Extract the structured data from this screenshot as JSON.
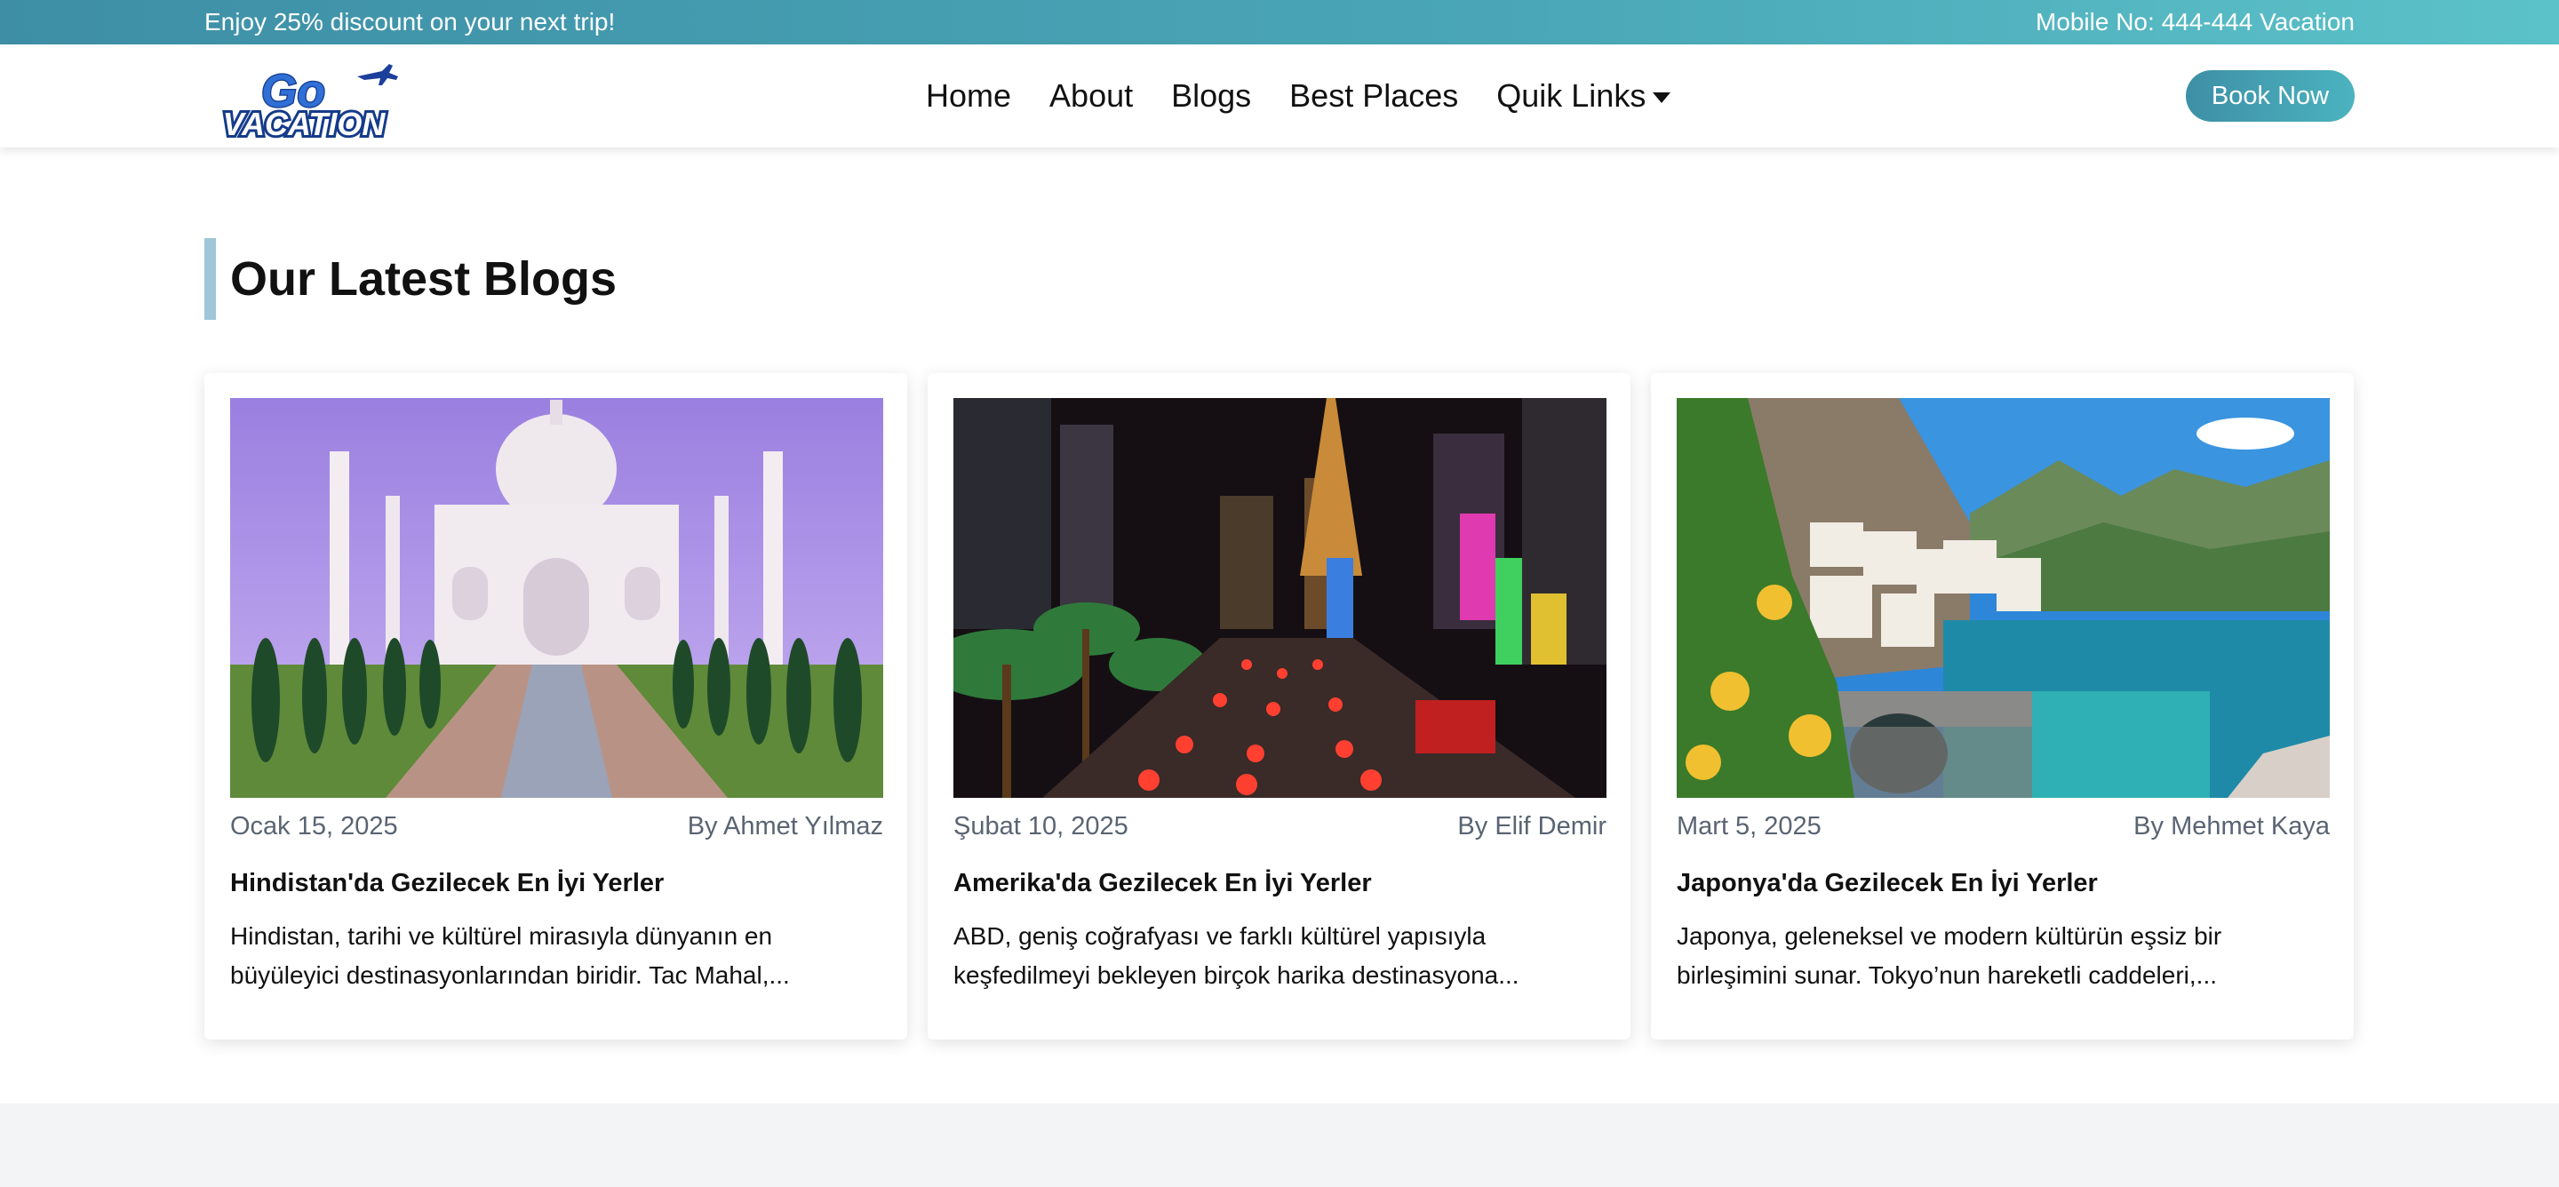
{
  "topbar": {
    "promo": "Enjoy 25% discount on your next trip!",
    "phone": "Mobile No: 444-444 Vacation",
    "gradient": [
      "#3e8fa6",
      "#5cc2c9"
    ]
  },
  "header": {
    "logo_top": "Go",
    "logo_bottom": "VACATION",
    "nav": [
      "Home",
      "About",
      "Blogs",
      "Best Places",
      "Quik Links"
    ],
    "dropdown_icon": "caret-down-icon",
    "book_label": "Book Now"
  },
  "section": {
    "title": "Our Latest Blogs",
    "accent": "#9fc6d9"
  },
  "blogs": [
    {
      "date": "Ocak 15, 2025",
      "author": "By Ahmet Yılmaz",
      "title": "Hindistan'da Gezilecek En İyi Yerler",
      "excerpt": "Hindistan, tarihi ve kültürel mirasıyla dünyanın en büyüleyici destinasyonlarından biridir. Tac Mahal,..."
    },
    {
      "date": "Şubat 10, 2025",
      "author": "By Elif Demir",
      "title": "Amerika'da Gezilecek En İyi Yerler",
      "excerpt": "ABD, geniş coğrafyası ve farklı kültürel yapısıyla keşfedilmeyi bekleyen birçok harika destinasyona..."
    },
    {
      "date": "Mart 5, 2025",
      "author": "By Mehmet Kaya",
      "title": "Japonya'da Gezilecek En İyi Yerler",
      "excerpt": "Japonya, geleneksel ve modern kültürün eşsiz bir birleşimini sunar. Tokyo’nun hareketli caddeleri,..."
    }
  ],
  "colors": {
    "brand": "#3e8fa6",
    "text_muted": "#5a6472",
    "footer_bg": "#f3f4f6"
  }
}
